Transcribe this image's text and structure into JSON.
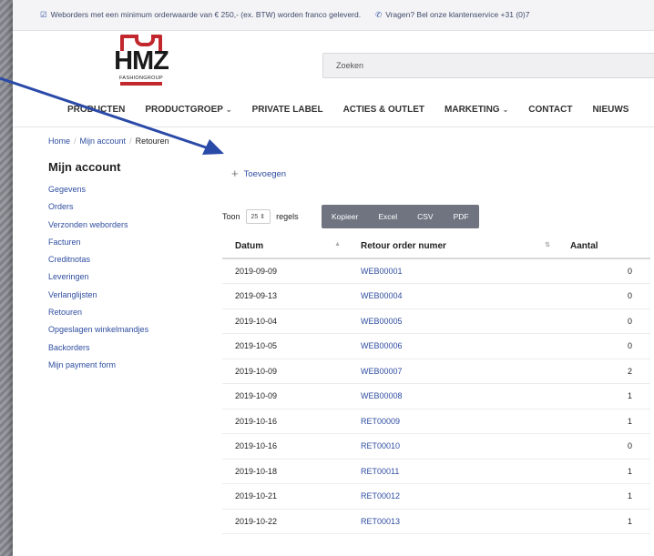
{
  "topbar": {
    "shipping_notice": "Weborders met een minimum orderwaarde van € 250,- (ex. BTW) worden franco geleverd.",
    "service_notice": "Vragen? Bel onze klantenservice +31 (0)7"
  },
  "logo": {
    "word": "HMZ",
    "sub": "FASHIONGROUP"
  },
  "search": {
    "placeholder": "Zoeken"
  },
  "nav": [
    {
      "label": "PRODUCTEN",
      "dropdown": false
    },
    {
      "label": "PRODUCTGROEP",
      "dropdown": true
    },
    {
      "label": "PRIVATE LABEL",
      "dropdown": false
    },
    {
      "label": "ACTIES & OUTLET",
      "dropdown": false
    },
    {
      "label": "MARKETING",
      "dropdown": true
    },
    {
      "label": "CONTACT",
      "dropdown": false
    },
    {
      "label": "NIEUWS",
      "dropdown": false
    }
  ],
  "breadcrumb": [
    "Home",
    "Mijn account",
    "Retouren"
  ],
  "sidebar": {
    "title": "Mijn account",
    "items": [
      "Gegevens",
      "Orders",
      "Verzonden weborders",
      "Facturen",
      "Creditnotas",
      "Leveringen",
      "Verlanglijsten",
      "Retouren",
      "Opgeslagen winkelmandjes",
      "Backorders",
      "Mijn payment form"
    ]
  },
  "add_label": "Toevoegen",
  "length": {
    "prefix": "Toon",
    "value": "25",
    "suffix": "regels"
  },
  "export_buttons": [
    "Kopieer",
    "Excel",
    "CSV",
    "PDF"
  ],
  "table": {
    "headers": [
      "Datum",
      "Retour order numer",
      "Aantal"
    ],
    "rows": [
      [
        "2019-09-09",
        "WEB00001",
        "0"
      ],
      [
        "2019-09-13",
        "WEB00004",
        "0"
      ],
      [
        "2019-10-04",
        "WEB00005",
        "0"
      ],
      [
        "2019-10-05",
        "WEB00006",
        "0"
      ],
      [
        "2019-10-09",
        "WEB00007",
        "2"
      ],
      [
        "2019-10-09",
        "WEB00008",
        "1"
      ],
      [
        "2019-10-16",
        "RET00009",
        "1"
      ],
      [
        "2019-10-16",
        "RET00010",
        "0"
      ],
      [
        "2019-10-18",
        "RET00011",
        "1"
      ],
      [
        "2019-10-21",
        "RET00012",
        "1"
      ],
      [
        "2019-10-22",
        "RET00013",
        "1"
      ]
    ]
  },
  "colors": {
    "link": "#2f4ea0",
    "brand_red": "#c1272d",
    "annotation_arrow": "#2a4aa8",
    "button_bar": "#6f7480"
  }
}
